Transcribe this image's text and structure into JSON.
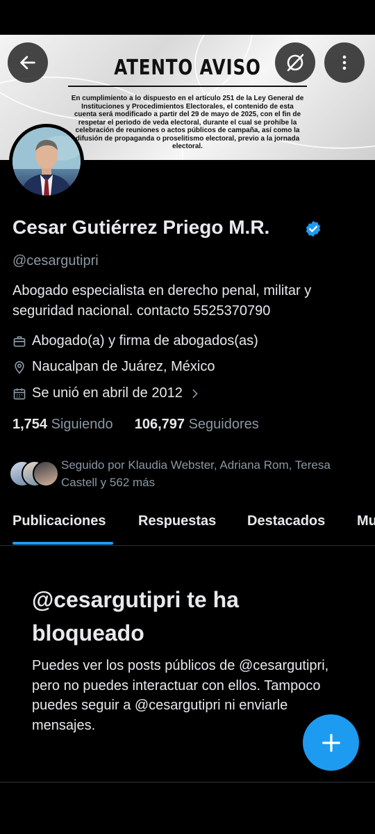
{
  "banner": {
    "title": "ATENTO AVISO",
    "notice": "En cumplimiento a lo dispuesto en el artículo 251 de la Ley General de Instituciones y Procedimientos Electorales, el contenido de esta cuenta será modificado a partir del 29 de mayo de 2025, con el fin de respetar el periodo de veda electoral, durante el cual se prohíbe la celebración de reuniones o actos públicos de campaña, así como la difusión de propaganda o proselitismo electoral, previo a la jornada electoral."
  },
  "profile": {
    "name": "Cesar Gutiérrez Priego M.R.",
    "handle": "@cesargutipri",
    "bio": "Abogado especialista en derecho penal, militar y seguridad nacional. contacto 5525370790",
    "category": "Abogado(a) y firma de abogados(as)",
    "location": "Naucalpan de Juárez, México",
    "joined": "Se unió en abril de 2012",
    "following_count": "1,754",
    "following_label": "Siguiendo",
    "followers_count": "106,797",
    "followers_label": "Seguidores",
    "followed_by": "Seguido por Klaudia Webster, Adriana Rom, Teresa Castell y 562 más"
  },
  "tabs": [
    "Publicaciones",
    "Respuestas",
    "Destacados",
    "Mu"
  ],
  "blocked": {
    "title": "@cesargutipri te ha bloqueado",
    "body": "Puedes ver los posts públicos de @cesargutipri, pero no puedes interactuar con ellos. Tampoco puedes seguir a @cesargutipri ni enviarle mensajes."
  },
  "icons": {
    "back": "arrow-left-icon",
    "grok": "grok-icon",
    "more": "more-vertical-icon",
    "verified": "verified-badge-icon",
    "category": "briefcase-icon",
    "location": "location-pin-icon",
    "calendar": "calendar-icon",
    "chevron": "chevron-right-icon",
    "compose": "plus-icon"
  },
  "colors": {
    "accent": "#1d9bf0",
    "background": "#000000",
    "secondary_text": "#8b98a5"
  }
}
